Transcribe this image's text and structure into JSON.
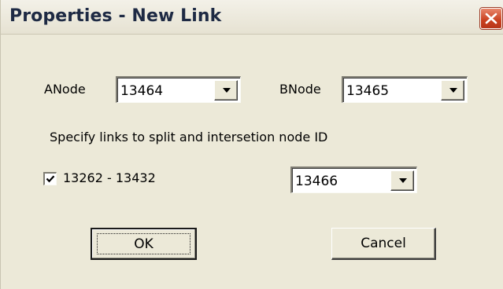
{
  "window": {
    "title": "Properties - New Link"
  },
  "icons": {
    "close": "close-icon",
    "dropdown": "chevron-down-icon",
    "check": "check-icon"
  },
  "colors": {
    "dialog_background": "#ece9d8",
    "close_button": "#c9401f"
  },
  "fields": {
    "anode_label": "ANode",
    "anode_value": "13464",
    "bnode_label": "BNode",
    "bnode_value": "13465"
  },
  "split": {
    "instruction": "Specify links to split and intersetion node ID",
    "link_checked": true,
    "link_label": "13262 - 13432",
    "node_value": "13466"
  },
  "buttons": {
    "ok": "OK",
    "cancel": "Cancel"
  }
}
